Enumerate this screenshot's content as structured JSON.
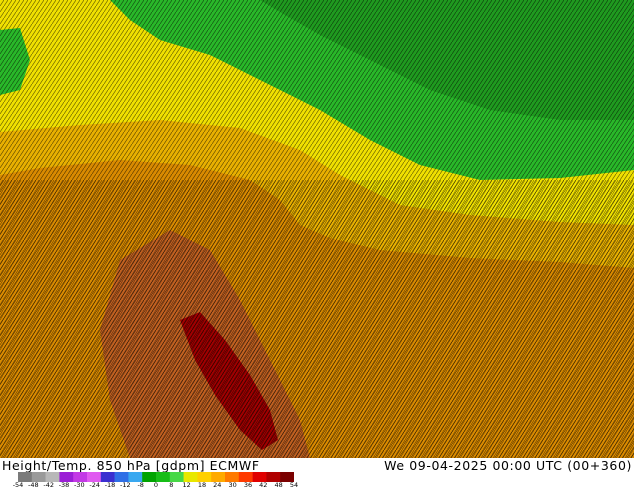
{
  "footer": {
    "product_title": "Height/Temp. 850 hPa [gdpm] ECMWF",
    "valid_time": "We 09-04-2025 00:00 UTC (00+360)"
  },
  "colorbar": {
    "tick_labels": [
      "-54",
      "-48",
      "-42",
      "-38",
      "-30",
      "-24",
      "-18",
      "-12",
      "-8",
      "0",
      "8",
      "12",
      "18",
      "24",
      "30",
      "36",
      "42",
      "48",
      "54"
    ],
    "colors": [
      "#7a7a7a",
      "#9a9a9a",
      "#b8b8b8",
      "#9b1fd6",
      "#c339e6",
      "#e05af0",
      "#3a2fd0",
      "#2f6fe6",
      "#39a8f0",
      "#00a300",
      "#16bd16",
      "#47d847",
      "#e8e800",
      "#ffd000",
      "#ffaa00",
      "#ff7a00",
      "#ff3a00",
      "#e00000",
      "#b00000",
      "#7a0000"
    ]
  },
  "map": {
    "regions": {
      "cold": "#29b829",
      "cool": "#1f9a1f",
      "transition": "#f0e000",
      "mild": "#e8b000",
      "warm": "#d98a00",
      "hot": "#c06020",
      "core": "#a00000"
    }
  }
}
